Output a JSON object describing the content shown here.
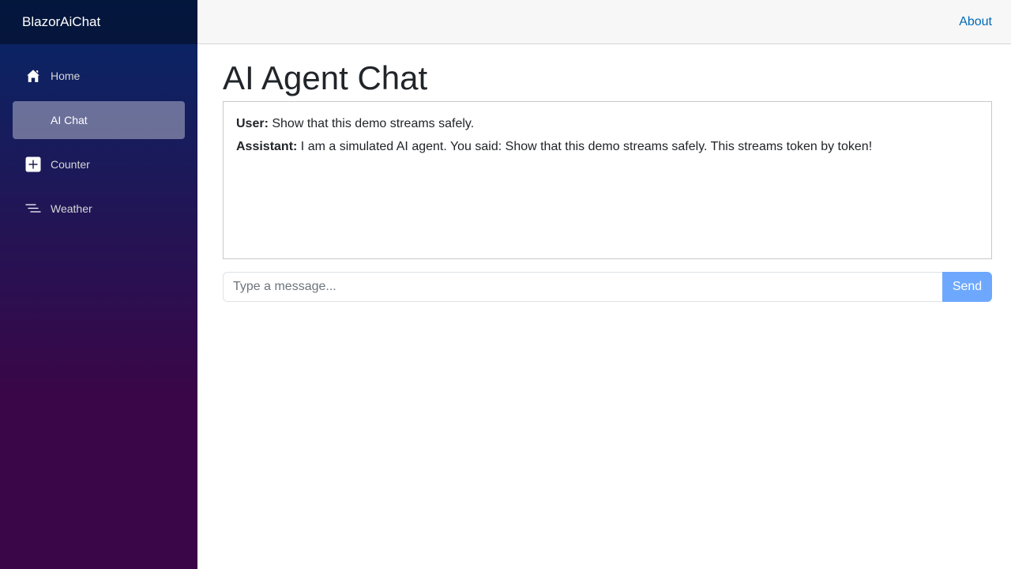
{
  "app": {
    "brand": "BlazorAiChat"
  },
  "sidebar": {
    "items": [
      {
        "label": "Home",
        "icon": "house-icon",
        "active": false
      },
      {
        "label": "AI Chat",
        "icon": "",
        "active": true
      },
      {
        "label": "Counter",
        "icon": "plus-square-icon",
        "active": false
      },
      {
        "label": "Weather",
        "icon": "list-nested-icon",
        "active": false
      }
    ]
  },
  "topbar": {
    "about_label": "About"
  },
  "main": {
    "title": "AI Agent Chat",
    "messages": [
      {
        "speaker": "User:",
        "text": " Show that this demo streams safely."
      },
      {
        "speaker": "Assistant:",
        "text": " I am a simulated AI agent. You said: Show that this demo streams safely. This streams token by token!"
      }
    ],
    "input": {
      "value": "",
      "placeholder": "Type a message..."
    },
    "send_label": "Send"
  },
  "colors": {
    "sidebar_top": "#052767",
    "sidebar_bottom": "#3a0647",
    "link": "#006bb7",
    "send_button": "#6ea8fe"
  }
}
